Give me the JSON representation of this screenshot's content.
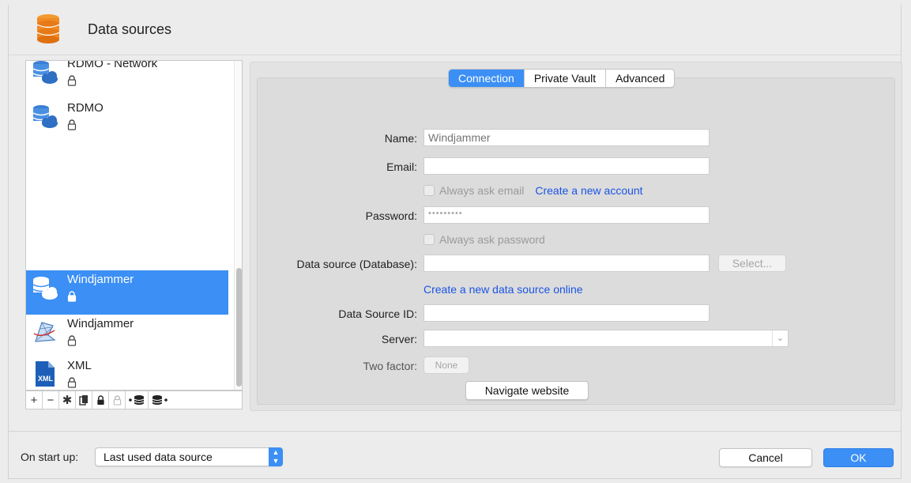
{
  "window": {
    "title": "Data sources"
  },
  "sidebar": {
    "items": [
      {
        "label": "RDMO - Network",
        "icon": "rdmo-cloud-database-icon",
        "locked": true,
        "selected": false
      },
      {
        "label": "RDMO",
        "icon": "rdmo-cloud-database-icon",
        "locked": true,
        "selected": false
      },
      {
        "label": "Windjammer",
        "icon": "cloud-database-icon",
        "locked": true,
        "selected": true
      },
      {
        "label": "Windjammer",
        "icon": "sql-server-icon",
        "locked": true,
        "selected": false
      },
      {
        "label": "XML",
        "icon": "xml-file-icon",
        "locked": true,
        "selected": false
      }
    ],
    "toolbar": {
      "add": "+",
      "remove": "−",
      "settings_icon": "gear-icon",
      "duplicate_icon": "duplicate-icon",
      "lock_icon": "lock-icon",
      "unlock_icon": "unlock-icon",
      "import_icon": "import-database-icon",
      "export_icon": "export-database-icon"
    }
  },
  "tabs": [
    {
      "label": "Connection",
      "active": true
    },
    {
      "label": "Private Vault",
      "active": false
    },
    {
      "label": "Advanced",
      "active": false
    }
  ],
  "form": {
    "name_label": "Name:",
    "name_placeholder": "Windjammer",
    "email_label": "Email:",
    "email_value": "",
    "always_ask_email": "Always ask email",
    "create_account_link": "Create a new account",
    "password_label": "Password:",
    "password_value": "•••••••••",
    "always_ask_password": "Always ask password",
    "data_source_label": "Data source (Database):",
    "data_source_value": "",
    "select_button": "Select...",
    "create_data_source_link": "Create a new data source online",
    "data_source_id_label": "Data Source ID:",
    "data_source_id_value": "",
    "server_label": "Server:",
    "server_value": "",
    "two_factor_label": "Two factor:",
    "two_factor_value": "None",
    "navigate_button": "Navigate website"
  },
  "footer": {
    "startup_label": "On start up:",
    "startup_value": "Last used data source",
    "cancel_button": "Cancel",
    "ok_button": "OK"
  },
  "colors": {
    "accent": "#3b8ff5",
    "link": "#1a54e5",
    "app_icon": "#f08a24"
  }
}
